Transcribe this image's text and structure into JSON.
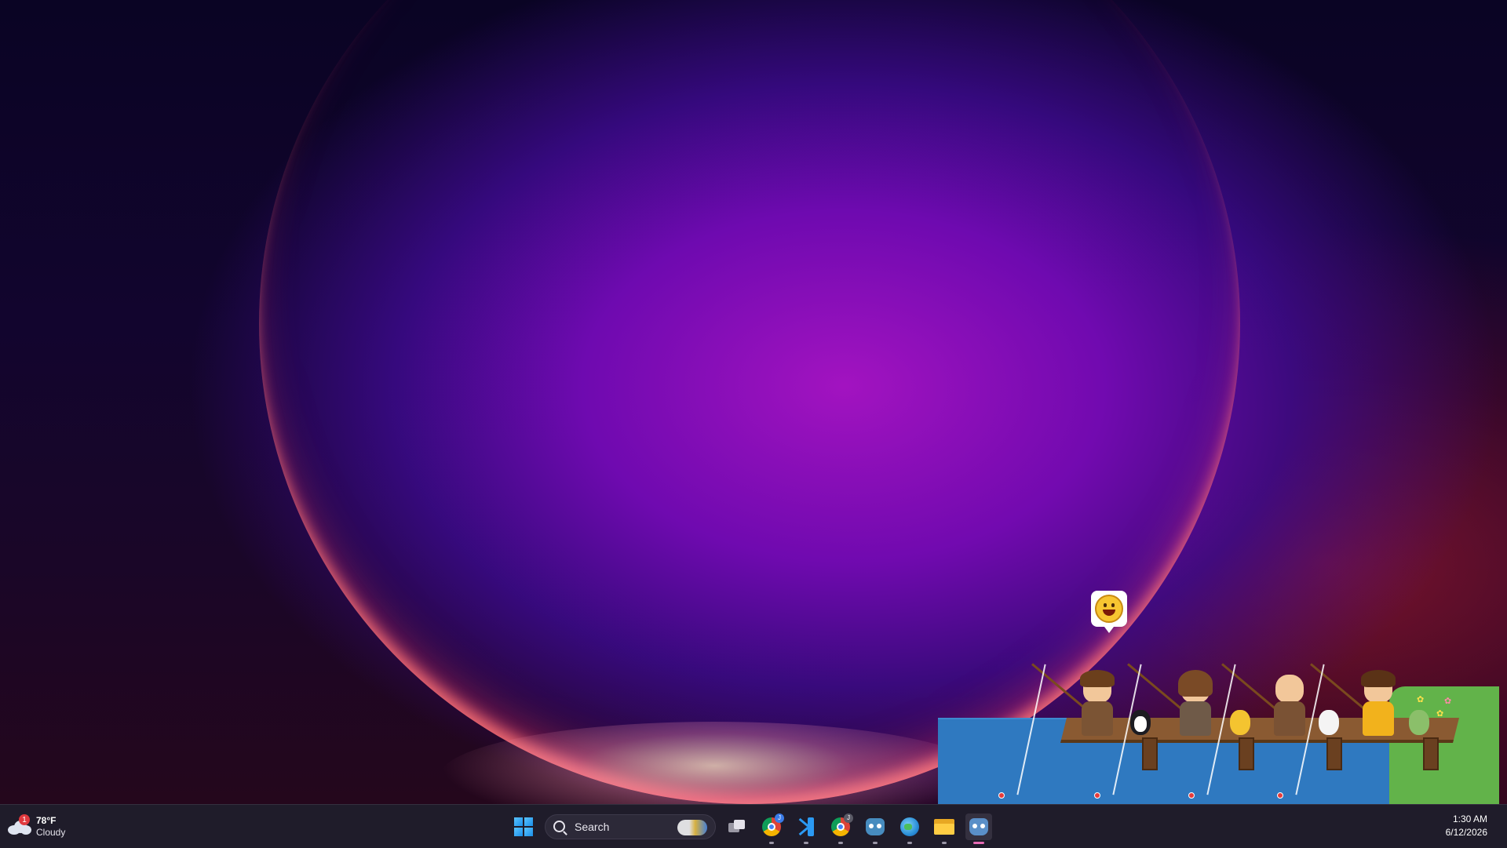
{
  "weather": {
    "temperature": "78°F",
    "condition": "Cloudy",
    "badge": "1",
    "icon": "cloud-icon"
  },
  "taskbar": {
    "search_placeholder": "Search",
    "icons": [
      {
        "name": "start-icon"
      },
      {
        "name": "search-icon"
      },
      {
        "name": "task-view-icon"
      },
      {
        "name": "chrome-icon",
        "badge": "J"
      },
      {
        "name": "vscode-icon"
      },
      {
        "name": "chrome-icon",
        "badge": "J"
      },
      {
        "name": "godot-icon"
      },
      {
        "name": "globe-icon"
      },
      {
        "name": "file-explorer-icon"
      },
      {
        "name": "godot-icon",
        "active": true
      }
    ],
    "accent": "#e66ab4"
  },
  "clock": {
    "time": "1:30 AM",
    "date": "6/12/2026"
  },
  "wallpaper": {
    "colors": [
      "#12052e",
      "#a614c8",
      "#ff3a6e"
    ]
  },
  "scene": {
    "speech_icon": "smiley-icon",
    "fishers": 4,
    "pets": [
      "penguin",
      "yellow-cat",
      "white-dog",
      "green-frog"
    ]
  }
}
